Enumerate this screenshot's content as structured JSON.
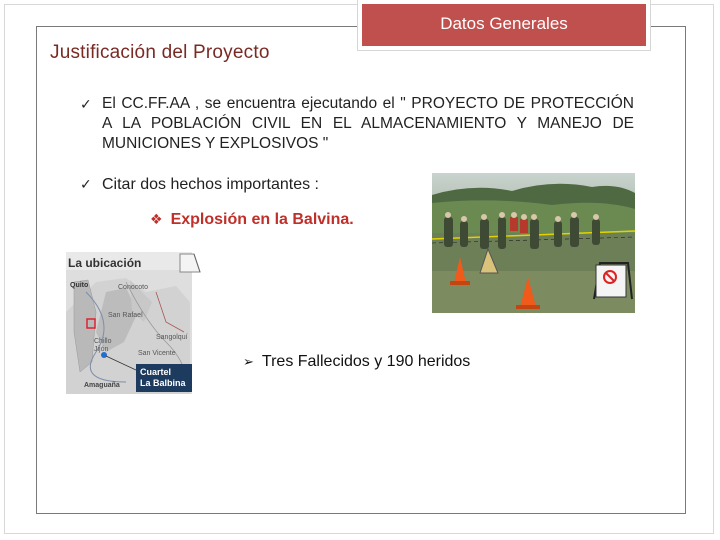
{
  "header": {
    "tab_label": "Datos Generales",
    "tab_color": "#c0504d"
  },
  "section_title": "Justificación del Proyecto",
  "bullets": [
    {
      "text": "El CC.FF.AA , se encuentra ejecutando el \" PROYECTO DE PROTECCIÓN A LA POBLACIÓN CIVIL EN EL ALMACENAMIENTO Y MANEJO DE MUNICIONES Y EXPLOSIVOS \""
    },
    {
      "text": "Citar dos hechos importantes :"
    }
  ],
  "sub_bullet": "Explosión en la Balvina.",
  "arrow_bullet": "Tres Fallecidos y 190 heridos",
  "map": {
    "title": "La ubicación",
    "labels": [
      "Quito",
      "Conocoto",
      "Sangolquí",
      "San Rafael",
      "Chillo Jijón",
      "San Vicente",
      "Amaguaña"
    ],
    "badge_line1": "Cuartel",
    "badge_line2": "La Balbina"
  },
  "icons": {
    "check": "check-icon",
    "diamond": "diamond-icon",
    "arrow": "arrow-right-icon"
  }
}
